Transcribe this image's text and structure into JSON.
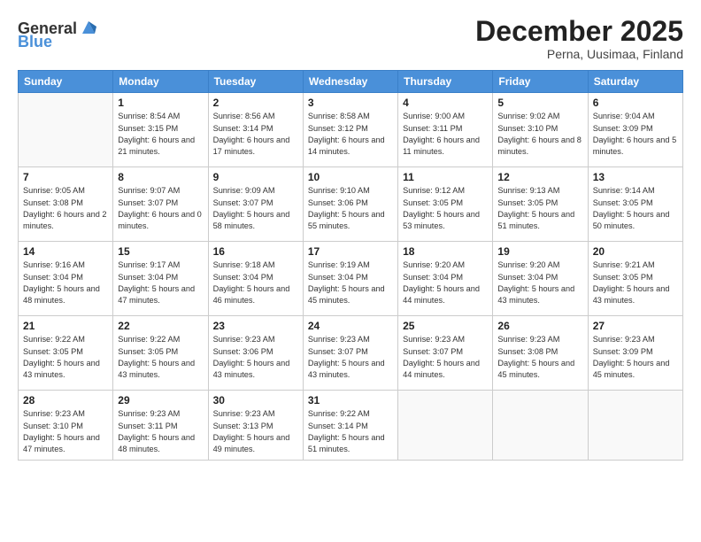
{
  "logo": {
    "general": "General",
    "blue": "Blue"
  },
  "title": "December 2025",
  "subtitle": "Perna, Uusimaa, Finland",
  "weekdays": [
    "Sunday",
    "Monday",
    "Tuesday",
    "Wednesday",
    "Thursday",
    "Friday",
    "Saturday"
  ],
  "weeks": [
    [
      {
        "day": "",
        "sunrise": "",
        "sunset": "",
        "daylight": ""
      },
      {
        "day": "1",
        "sunrise": "Sunrise: 8:54 AM",
        "sunset": "Sunset: 3:15 PM",
        "daylight": "Daylight: 6 hours and 21 minutes."
      },
      {
        "day": "2",
        "sunrise": "Sunrise: 8:56 AM",
        "sunset": "Sunset: 3:14 PM",
        "daylight": "Daylight: 6 hours and 17 minutes."
      },
      {
        "day": "3",
        "sunrise": "Sunrise: 8:58 AM",
        "sunset": "Sunset: 3:12 PM",
        "daylight": "Daylight: 6 hours and 14 minutes."
      },
      {
        "day": "4",
        "sunrise": "Sunrise: 9:00 AM",
        "sunset": "Sunset: 3:11 PM",
        "daylight": "Daylight: 6 hours and 11 minutes."
      },
      {
        "day": "5",
        "sunrise": "Sunrise: 9:02 AM",
        "sunset": "Sunset: 3:10 PM",
        "daylight": "Daylight: 6 hours and 8 minutes."
      },
      {
        "day": "6",
        "sunrise": "Sunrise: 9:04 AM",
        "sunset": "Sunset: 3:09 PM",
        "daylight": "Daylight: 6 hours and 5 minutes."
      }
    ],
    [
      {
        "day": "7",
        "sunrise": "Sunrise: 9:05 AM",
        "sunset": "Sunset: 3:08 PM",
        "daylight": "Daylight: 6 hours and 2 minutes."
      },
      {
        "day": "8",
        "sunrise": "Sunrise: 9:07 AM",
        "sunset": "Sunset: 3:07 PM",
        "daylight": "Daylight: 6 hours and 0 minutes."
      },
      {
        "day": "9",
        "sunrise": "Sunrise: 9:09 AM",
        "sunset": "Sunset: 3:07 PM",
        "daylight": "Daylight: 5 hours and 58 minutes."
      },
      {
        "day": "10",
        "sunrise": "Sunrise: 9:10 AM",
        "sunset": "Sunset: 3:06 PM",
        "daylight": "Daylight: 5 hours and 55 minutes."
      },
      {
        "day": "11",
        "sunrise": "Sunrise: 9:12 AM",
        "sunset": "Sunset: 3:05 PM",
        "daylight": "Daylight: 5 hours and 53 minutes."
      },
      {
        "day": "12",
        "sunrise": "Sunrise: 9:13 AM",
        "sunset": "Sunset: 3:05 PM",
        "daylight": "Daylight: 5 hours and 51 minutes."
      },
      {
        "day": "13",
        "sunrise": "Sunrise: 9:14 AM",
        "sunset": "Sunset: 3:05 PM",
        "daylight": "Daylight: 5 hours and 50 minutes."
      }
    ],
    [
      {
        "day": "14",
        "sunrise": "Sunrise: 9:16 AM",
        "sunset": "Sunset: 3:04 PM",
        "daylight": "Daylight: 5 hours and 48 minutes."
      },
      {
        "day": "15",
        "sunrise": "Sunrise: 9:17 AM",
        "sunset": "Sunset: 3:04 PM",
        "daylight": "Daylight: 5 hours and 47 minutes."
      },
      {
        "day": "16",
        "sunrise": "Sunrise: 9:18 AM",
        "sunset": "Sunset: 3:04 PM",
        "daylight": "Daylight: 5 hours and 46 minutes."
      },
      {
        "day": "17",
        "sunrise": "Sunrise: 9:19 AM",
        "sunset": "Sunset: 3:04 PM",
        "daylight": "Daylight: 5 hours and 45 minutes."
      },
      {
        "day": "18",
        "sunrise": "Sunrise: 9:20 AM",
        "sunset": "Sunset: 3:04 PM",
        "daylight": "Daylight: 5 hours and 44 minutes."
      },
      {
        "day": "19",
        "sunrise": "Sunrise: 9:20 AM",
        "sunset": "Sunset: 3:04 PM",
        "daylight": "Daylight: 5 hours and 43 minutes."
      },
      {
        "day": "20",
        "sunrise": "Sunrise: 9:21 AM",
        "sunset": "Sunset: 3:05 PM",
        "daylight": "Daylight: 5 hours and 43 minutes."
      }
    ],
    [
      {
        "day": "21",
        "sunrise": "Sunrise: 9:22 AM",
        "sunset": "Sunset: 3:05 PM",
        "daylight": "Daylight: 5 hours and 43 minutes."
      },
      {
        "day": "22",
        "sunrise": "Sunrise: 9:22 AM",
        "sunset": "Sunset: 3:05 PM",
        "daylight": "Daylight: 5 hours and 43 minutes."
      },
      {
        "day": "23",
        "sunrise": "Sunrise: 9:23 AM",
        "sunset": "Sunset: 3:06 PM",
        "daylight": "Daylight: 5 hours and 43 minutes."
      },
      {
        "day": "24",
        "sunrise": "Sunrise: 9:23 AM",
        "sunset": "Sunset: 3:07 PM",
        "daylight": "Daylight: 5 hours and 43 minutes."
      },
      {
        "day": "25",
        "sunrise": "Sunrise: 9:23 AM",
        "sunset": "Sunset: 3:07 PM",
        "daylight": "Daylight: 5 hours and 44 minutes."
      },
      {
        "day": "26",
        "sunrise": "Sunrise: 9:23 AM",
        "sunset": "Sunset: 3:08 PM",
        "daylight": "Daylight: 5 hours and 45 minutes."
      },
      {
        "day": "27",
        "sunrise": "Sunrise: 9:23 AM",
        "sunset": "Sunset: 3:09 PM",
        "daylight": "Daylight: 5 hours and 45 minutes."
      }
    ],
    [
      {
        "day": "28",
        "sunrise": "Sunrise: 9:23 AM",
        "sunset": "Sunset: 3:10 PM",
        "daylight": "Daylight: 5 hours and 47 minutes."
      },
      {
        "day": "29",
        "sunrise": "Sunrise: 9:23 AM",
        "sunset": "Sunset: 3:11 PM",
        "daylight": "Daylight: 5 hours and 48 minutes."
      },
      {
        "day": "30",
        "sunrise": "Sunrise: 9:23 AM",
        "sunset": "Sunset: 3:13 PM",
        "daylight": "Daylight: 5 hours and 49 minutes."
      },
      {
        "day": "31",
        "sunrise": "Sunrise: 9:22 AM",
        "sunset": "Sunset: 3:14 PM",
        "daylight": "Daylight: 5 hours and 51 minutes."
      },
      {
        "day": "",
        "sunrise": "",
        "sunset": "",
        "daylight": ""
      },
      {
        "day": "",
        "sunrise": "",
        "sunset": "",
        "daylight": ""
      },
      {
        "day": "",
        "sunrise": "",
        "sunset": "",
        "daylight": ""
      }
    ]
  ]
}
